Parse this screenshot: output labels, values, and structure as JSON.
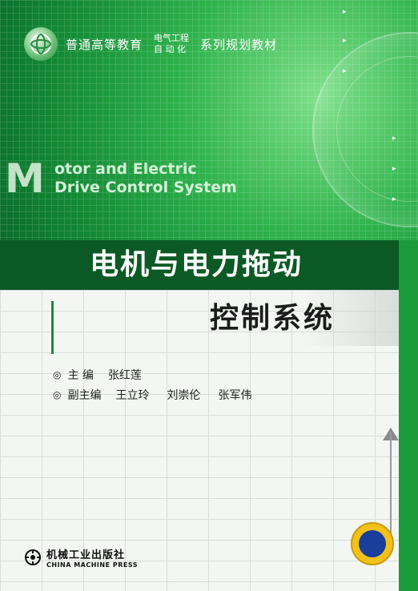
{
  "series": {
    "name_left": "普通高等教育",
    "name_mid_line1": "电气工程",
    "name_mid_line2": "自 动 化",
    "name_right": "系列规划教材"
  },
  "english_title": {
    "initial": "M",
    "line1": "otor and Electric",
    "line2": "Drive Control System"
  },
  "title": {
    "line1": "电机与电力拖动",
    "line2": "控制系统"
  },
  "authors": [
    {
      "role": "主  编",
      "names": [
        "张红莲"
      ]
    },
    {
      "role": "副主编",
      "names": [
        "王立玲",
        "刘崇伦",
        "张军伟"
      ]
    }
  ],
  "publisher": {
    "name_cn": "机械工业出版社",
    "name_en": "CHINA MACHINE PRESS"
  },
  "colors": {
    "primary_green": "#1b9a3c",
    "dark_green": "#0b5a25"
  }
}
